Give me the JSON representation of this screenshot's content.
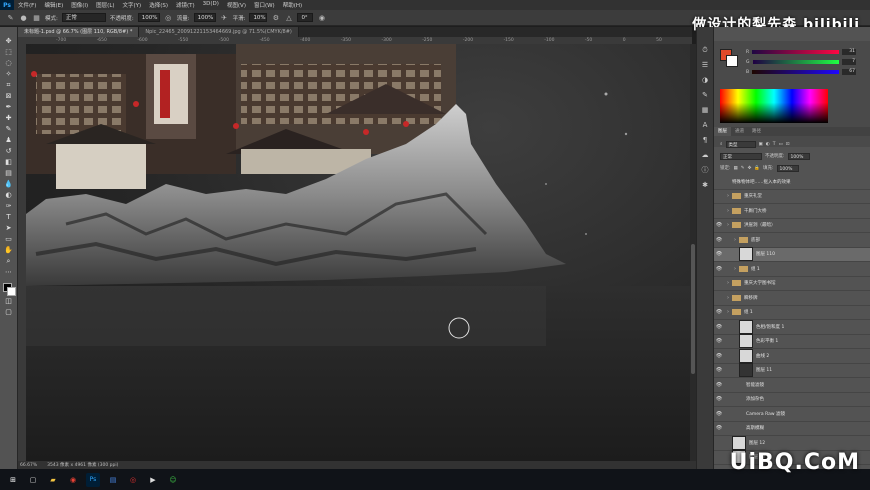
{
  "app": {
    "logo": "Ps"
  },
  "menu": [
    "文件(F)",
    "编辑(E)",
    "图像(I)",
    "图层(L)",
    "文字(Y)",
    "选择(S)",
    "滤镜(T)",
    "3D(D)",
    "视图(V)",
    "窗口(W)",
    "帮助(H)"
  ],
  "options": {
    "mode_label": "模式:",
    "mode_value": "正常",
    "opacity_label": "不透明度:",
    "opacity_value": "100%",
    "flow_label": "流量:",
    "flow_value": "100%",
    "smooth_label": "平滑:",
    "smooth_value": "10%",
    "angle_value": "0°"
  },
  "watermark_text": "做设计的梨先森 bilibili",
  "tabs": [
    {
      "label": "未标题-1.psd @ 66.7% (图层 110, RGB/8#) *",
      "active": true
    },
    {
      "label": "Npic_22465_20091221153464669.jpg @ 71.5%(CMYK/8#)",
      "active": false
    }
  ],
  "ruler_ticks": [
    "-700",
    "-650",
    "-600",
    "-550",
    "-500",
    "-450",
    "-400",
    "-350",
    "-300",
    "-250",
    "-200",
    "-150",
    "-100",
    "-50",
    "0",
    "50"
  ],
  "status": {
    "zoom": "66.67%",
    "doc": "3543 像素 x 4961 像素 (300 ppi)"
  },
  "color_panel": {
    "values": [
      {
        "label": "R",
        "value": "31"
      },
      {
        "label": "G",
        "value": "7"
      },
      {
        "label": "B",
        "value": "67"
      }
    ]
  },
  "layers": {
    "tabs": [
      "图层",
      "通道",
      "路径"
    ],
    "filter_label": "类型",
    "blend_value": "正常",
    "opacity_label": "不透明度:",
    "opacity_value": "100%",
    "lock_label": "锁定:",
    "fill_label": "填充:",
    "fill_value": "100%",
    "rows": [
      {
        "name": "特殊物体吧……抠入本的效果",
        "kind": "text",
        "eye": false,
        "indent": 0,
        "selected": false
      },
      {
        "name": "重庆礼堂",
        "kind": "folder",
        "eye": false,
        "indent": 0,
        "selected": false
      },
      {
        "name": "千厮门大桥",
        "kind": "folder",
        "eye": false,
        "indent": 0,
        "selected": false
      },
      {
        "name": "洪崖洞（最暗）",
        "kind": "folder",
        "eye": true,
        "indent": 0,
        "selected": false
      },
      {
        "name": "底部",
        "kind": "folder",
        "eye": true,
        "indent": 1,
        "selected": false
      },
      {
        "name": "图层 110",
        "kind": "layer",
        "eye": true,
        "indent": 1,
        "selected": true
      },
      {
        "name": "组 1",
        "kind": "folder",
        "eye": true,
        "indent": 1,
        "selected": false
      },
      {
        "name": "重庆大学图书馆",
        "kind": "folder",
        "eye": false,
        "indent": 0,
        "selected": false
      },
      {
        "name": "瞬移牌",
        "kind": "folder",
        "eye": false,
        "indent": 0,
        "selected": false
      },
      {
        "name": "组 1",
        "kind": "folder",
        "eye": true,
        "indent": 0,
        "selected": false
      },
      {
        "name": "色相/饱和度 1",
        "kind": "adjust",
        "eye": true,
        "indent": 1,
        "selected": false
      },
      {
        "name": "色彩平衡 1",
        "kind": "adjust",
        "eye": true,
        "indent": 1,
        "selected": false
      },
      {
        "name": "曲线 2",
        "kind": "adjust",
        "eye": true,
        "indent": 1,
        "selected": false
      },
      {
        "name": "图层 11",
        "kind": "layer-dark",
        "eye": true,
        "indent": 1,
        "selected": false
      },
      {
        "name": "智能滤镜",
        "kind": "sub",
        "eye": true,
        "indent": 2,
        "selected": false
      },
      {
        "name": "添加杂色",
        "kind": "sub",
        "eye": true,
        "indent": 2,
        "selected": false
      },
      {
        "name": "Camera Raw 滤镜",
        "kind": "sub",
        "eye": true,
        "indent": 2,
        "selected": false
      },
      {
        "name": "高斯模糊",
        "kind": "sub",
        "eye": true,
        "indent": 2,
        "selected": false
      },
      {
        "name": "图层 12",
        "kind": "layer",
        "eye": false,
        "indent": 0,
        "selected": false
      },
      {
        "name": "图层 13",
        "kind": "layer",
        "eye": false,
        "indent": 0,
        "selected": false
      }
    ]
  },
  "taskbar": {
    "search_placeholder": ""
  },
  "brand": "UiBQ.CoM"
}
